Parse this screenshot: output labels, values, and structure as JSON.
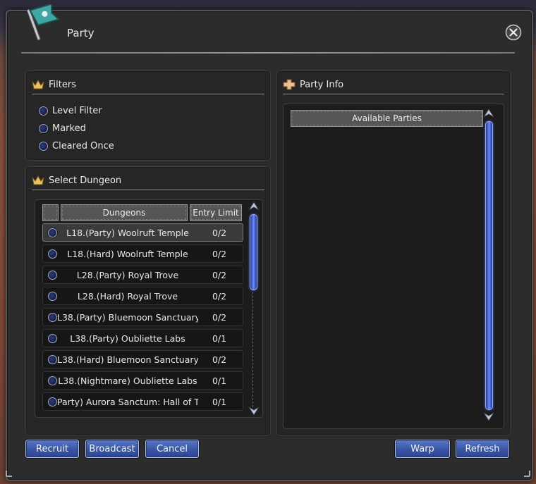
{
  "window": {
    "title": "Party"
  },
  "filters": {
    "title": "Filters",
    "options": [
      "Level Filter",
      "Marked",
      "Cleared Once"
    ]
  },
  "select_dungeon": {
    "title": "Select Dungeon",
    "columns": {
      "dungeons": "Dungeons",
      "entry_limit": "Entry Limit"
    },
    "rows": [
      {
        "name": "L18.(Party) Woolruft Temple",
        "limit": "0/2",
        "selected": true
      },
      {
        "name": "L18.(Hard) Woolruft Temple",
        "limit": "0/2"
      },
      {
        "name": "L28.(Party) Royal Trove",
        "limit": "0/2"
      },
      {
        "name": "L28.(Hard) Royal Trove",
        "limit": "0/2"
      },
      {
        "name": "L38.(Party) Bluemoon Sanctuary",
        "limit": "0/2"
      },
      {
        "name": "L38.(Party) Oubliette Labs",
        "limit": "0/1"
      },
      {
        "name": "L38.(Hard) Bluemoon Sanctuary",
        "limit": "0/2"
      },
      {
        "name": "L38.(Nightmare) Oubliette Labs",
        "limit": "0/1"
      },
      {
        "name": "Party) Aurora Sanctum: Hall of T",
        "limit": "0/1"
      }
    ]
  },
  "party_info": {
    "title": "Party Info",
    "header": "Available Parties"
  },
  "buttons": {
    "recruit": "Recruit",
    "broadcast": "Broadcast",
    "cancel": "Cancel",
    "warp": "Warp",
    "refresh": "Refresh"
  },
  "colors": {
    "accent_blue": "#3a57a8",
    "panel_bg": "#262626"
  }
}
